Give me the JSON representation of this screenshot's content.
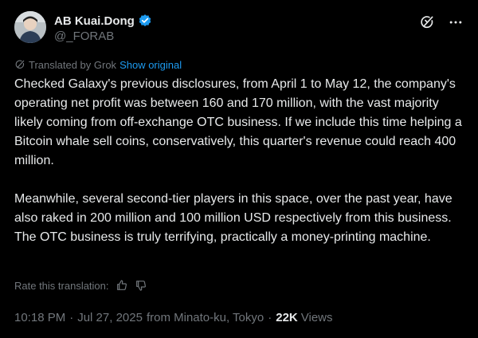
{
  "author": {
    "display_name": "AB Kuai.Dong",
    "handle": "@_FORAB"
  },
  "icons": {
    "verified": "verified-badge-icon",
    "grok": "grok-icon",
    "more": "more-icon",
    "thumbs_up": "thumbs-up-icon",
    "thumbs_down": "thumbs-down-icon"
  },
  "colors": {
    "background": "#000000",
    "text": "#e7e9ea",
    "secondary": "#71767b",
    "accent": "#1d9bf0"
  },
  "translation": {
    "label": "Translated by Grok",
    "show_original": "Show original"
  },
  "post": {
    "paragraph_1": "Checked Galaxy's previous disclosures, from April 1 to May 12, the company's operating net profit was between 160 and 170 million, with the vast majority likely coming from off-exchange OTC business. If we include this time helping a Bitcoin whale sell coins, conservatively, this quarter's revenue could reach 400 million.",
    "paragraph_2": "Meanwhile, several second-tier players in this space, over the past year, have also raked in 200 million and 100 million USD respectively from this business. The OTC business is truly terrifying, practically a money-printing machine."
  },
  "rate": {
    "label": "Rate this translation:"
  },
  "meta": {
    "time": "10:18 PM",
    "date": "Jul 27, 2025",
    "location": "from Minato-ku, Tokyo",
    "dot": "·",
    "views_count": "22K",
    "views_label": "Views"
  }
}
